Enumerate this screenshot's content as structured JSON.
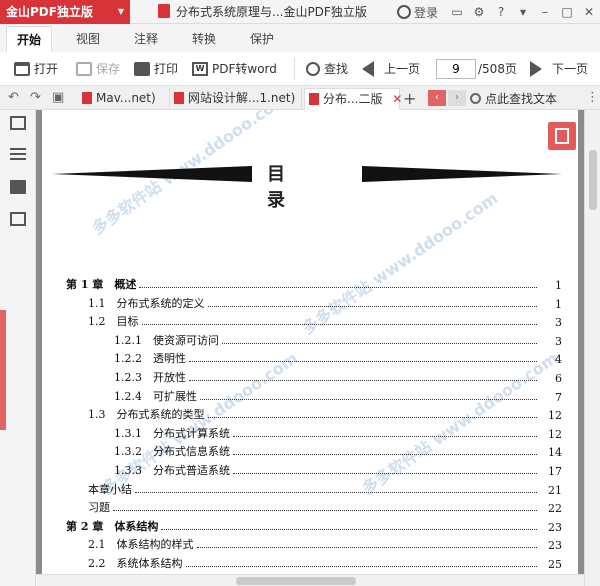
{
  "titlebar": {
    "app_name": "金山PDF独立版",
    "doc_title": "分布式系统原理与...金山PDF独立版",
    "login_label": "登录",
    "help_label": "?"
  },
  "ribbon": {
    "tabs": [
      "开始",
      "视图",
      "注释",
      "转换",
      "保护"
    ],
    "active_tab": "开始"
  },
  "toolbar": {
    "open_label": "打开",
    "save_label": "保存",
    "print_label": "打印",
    "pdf_to_word_label": "PDF转word",
    "find_label": "查找",
    "prev_page_label": "上一页",
    "current_page": "9",
    "total_pages": "/508页",
    "next_page_label": "下一页"
  },
  "docbar": {
    "tabs": [
      {
        "label": "Mav...net)"
      },
      {
        "label": "网站设计解...1.net)"
      },
      {
        "label": "分布...二版"
      }
    ],
    "active_tab_index": 2,
    "find_in_text_label": "点此查找文本"
  },
  "document": {
    "heading": "目录",
    "toc": [
      {
        "label": "第 1 章　概述",
        "page": "1",
        "level": 0
      },
      {
        "label": "1.1　分布式系统的定义",
        "page": "1",
        "level": 1
      },
      {
        "label": "1.2　目标",
        "page": "3",
        "level": 1
      },
      {
        "label": "1.2.1　使资源可访问",
        "page": "3",
        "level": 2
      },
      {
        "label": "1.2.2　透明性",
        "page": "4",
        "level": 2
      },
      {
        "label": "1.2.3　开放性",
        "page": "6",
        "level": 2
      },
      {
        "label": "1.2.4　可扩展性",
        "page": "7",
        "level": 2
      },
      {
        "label": "1.3　分布式系统的类型",
        "page": "12",
        "level": 1
      },
      {
        "label": "1.3.1　分布式计算系统",
        "page": "12",
        "level": 2
      },
      {
        "label": "1.3.2　分布式信息系统",
        "page": "14",
        "level": 2
      },
      {
        "label": "1.3.3　分布式普适系统",
        "page": "17",
        "level": 2
      },
      {
        "label": "本章小结",
        "page": "21",
        "level": 1
      },
      {
        "label": "习题",
        "page": "22",
        "level": 1
      },
      {
        "label": "第 2 章　体系结构",
        "page": "23",
        "level": 0
      },
      {
        "label": "2.1　体系结构的样式",
        "page": "23",
        "level": 1
      },
      {
        "label": "2.2　系统体系结构",
        "page": "25",
        "level": 1
      }
    ],
    "watermark_text": "多多软件站 www.ddooo.com"
  },
  "colors": {
    "accent": "#d9333a",
    "nav_red": "#e06464"
  }
}
